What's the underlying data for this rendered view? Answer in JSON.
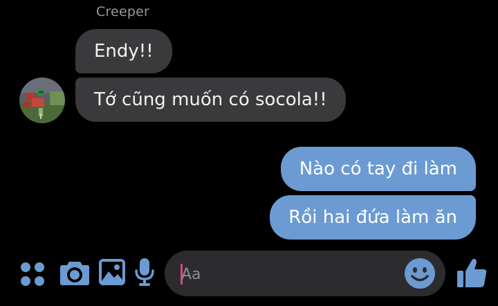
{
  "conversation": {
    "sender_name": "Creeper",
    "messages": [
      {
        "direction": "incoming",
        "text": "Endy!!"
      },
      {
        "direction": "incoming",
        "text": "Tớ cũng muốn có socola!!"
      },
      {
        "direction": "outgoing",
        "text": "Nào có tay đi làm"
      },
      {
        "direction": "outgoing",
        "text": "Rồi hai đứa làm ăn"
      }
    ]
  },
  "composer": {
    "placeholder": "Aa",
    "value": ""
  },
  "icons": {
    "apps": "four-dots-icon",
    "camera": "camera-icon",
    "gallery": "image-icon",
    "voice": "microphone-icon",
    "emoji": "smiley-icon",
    "like": "thumbs-up-icon"
  },
  "colors": {
    "background": "#000000",
    "incoming_bubble": "#3a3a3c",
    "outgoing_bubble": "#6b9bd2",
    "accent": "#6b9bd2",
    "caret": "#e0457b"
  }
}
